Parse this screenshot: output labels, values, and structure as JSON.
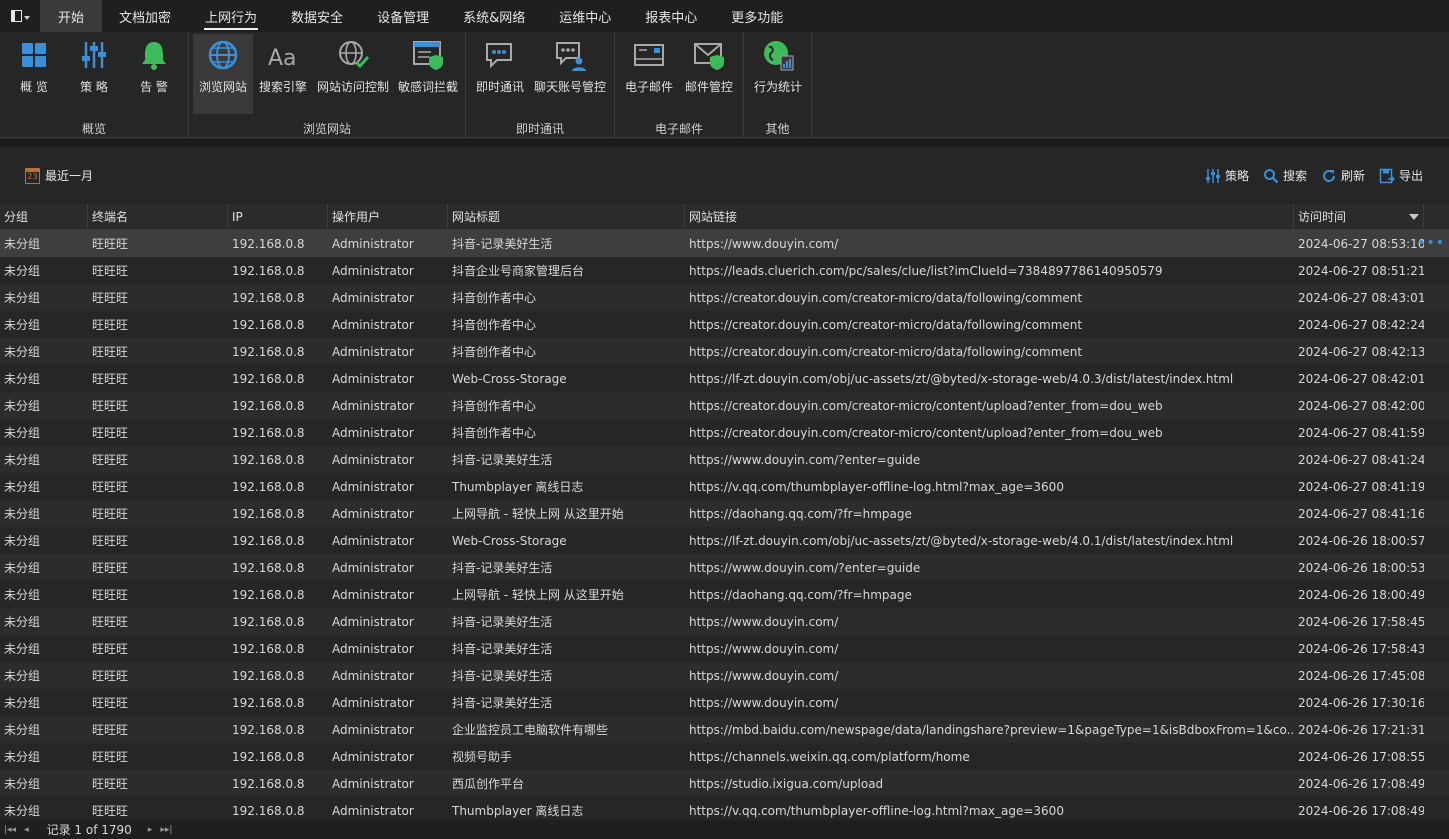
{
  "menu": {
    "tabs": [
      "开始",
      "文档加密",
      "上网行为",
      "数据安全",
      "设备管理",
      "系统&网络",
      "运维中心",
      "报表中心",
      "更多功能"
    ],
    "active_index": 2
  },
  "ribbon": {
    "groups": [
      {
        "label": "概览",
        "buttons": [
          {
            "label": "概 览",
            "icon": "overview-grid-icon"
          },
          {
            "label": "策 略",
            "icon": "policy-sliders-icon"
          },
          {
            "label": "告 警",
            "icon": "alarm-bell-icon"
          }
        ]
      },
      {
        "label": "浏览网站",
        "buttons": [
          {
            "label": "浏览网站",
            "icon": "globe-icon"
          },
          {
            "label": "搜索引擎",
            "icon": "search-engine-aa-icon"
          },
          {
            "label": "网站访问控制",
            "icon": "globe-check-icon"
          },
          {
            "label": "敏感词拦截",
            "icon": "browser-shield-icon"
          }
        ]
      },
      {
        "label": "即时通讯",
        "buttons": [
          {
            "label": "即时通讯",
            "icon": "chat-bubble-icon"
          },
          {
            "label": "聊天账号管控",
            "icon": "chat-user-icon"
          }
        ]
      },
      {
        "label": "电子邮件",
        "buttons": [
          {
            "label": "电子邮件",
            "icon": "mail-icon"
          },
          {
            "label": "邮件管控",
            "icon": "mail-shield-icon"
          }
        ]
      },
      {
        "label": "其他",
        "buttons": [
          {
            "label": "行为统计",
            "icon": "globe-stats-icon"
          }
        ]
      }
    ]
  },
  "toolbar": {
    "date_filter": "最近一月",
    "calendar_day": "23",
    "policy": "策略",
    "search": "搜索",
    "refresh": "刷新",
    "export": "导出"
  },
  "table": {
    "columns": [
      "分组",
      "终端名",
      "IP",
      "操作用户",
      "网站标题",
      "网站链接",
      "访问时间"
    ],
    "rows": [
      [
        "未分组",
        "旺旺旺",
        "192.168.0.8",
        "Administrator",
        "抖音-记录美好生活",
        "https://www.douyin.com/",
        "2024-06-27 08:53:10"
      ],
      [
        "未分组",
        "旺旺旺",
        "192.168.0.8",
        "Administrator",
        "抖音企业号商家管理后台",
        "https://leads.cluerich.com/pc/sales/clue/list?imClueId=7384897786140950579",
        "2024-06-27 08:51:21"
      ],
      [
        "未分组",
        "旺旺旺",
        "192.168.0.8",
        "Administrator",
        "抖音创作者中心",
        "https://creator.douyin.com/creator-micro/data/following/comment",
        "2024-06-27 08:43:01"
      ],
      [
        "未分组",
        "旺旺旺",
        "192.168.0.8",
        "Administrator",
        "抖音创作者中心",
        "https://creator.douyin.com/creator-micro/data/following/comment",
        "2024-06-27 08:42:24"
      ],
      [
        "未分组",
        "旺旺旺",
        "192.168.0.8",
        "Administrator",
        "抖音创作者中心",
        "https://creator.douyin.com/creator-micro/data/following/comment",
        "2024-06-27 08:42:13"
      ],
      [
        "未分组",
        "旺旺旺",
        "192.168.0.8",
        "Administrator",
        "Web-Cross-Storage",
        "https://lf-zt.douyin.com/obj/uc-assets/zt/@byted/x-storage-web/4.0.3/dist/latest/index.html",
        "2024-06-27 08:42:01"
      ],
      [
        "未分组",
        "旺旺旺",
        "192.168.0.8",
        "Administrator",
        "抖音创作者中心",
        "https://creator.douyin.com/creator-micro/content/upload?enter_from=dou_web",
        "2024-06-27 08:42:00"
      ],
      [
        "未分组",
        "旺旺旺",
        "192.168.0.8",
        "Administrator",
        "抖音创作者中心",
        "https://creator.douyin.com/creator-micro/content/upload?enter_from=dou_web",
        "2024-06-27 08:41:59"
      ],
      [
        "未分组",
        "旺旺旺",
        "192.168.0.8",
        "Administrator",
        "抖音-记录美好生活",
        "https://www.douyin.com/?enter=guide",
        "2024-06-27 08:41:24"
      ],
      [
        "未分组",
        "旺旺旺",
        "192.168.0.8",
        "Administrator",
        "Thumbplayer 离线日志",
        "https://v.qq.com/thumbplayer-offline-log.html?max_age=3600",
        "2024-06-27 08:41:19"
      ],
      [
        "未分组",
        "旺旺旺",
        "192.168.0.8",
        "Administrator",
        "上网导航 - 轻快上网 从这里开始",
        "https://daohang.qq.com/?fr=hmpage",
        "2024-06-27 08:41:16"
      ],
      [
        "未分组",
        "旺旺旺",
        "192.168.0.8",
        "Administrator",
        "Web-Cross-Storage",
        "https://lf-zt.douyin.com/obj/uc-assets/zt/@byted/x-storage-web/4.0.1/dist/latest/index.html",
        "2024-06-26 18:00:57"
      ],
      [
        "未分组",
        "旺旺旺",
        "192.168.0.8",
        "Administrator",
        "抖音-记录美好生活",
        "https://www.douyin.com/?enter=guide",
        "2024-06-26 18:00:53"
      ],
      [
        "未分组",
        "旺旺旺",
        "192.168.0.8",
        "Administrator",
        "上网导航 - 轻快上网 从这里开始",
        "https://daohang.qq.com/?fr=hmpage",
        "2024-06-26 18:00:49"
      ],
      [
        "未分组",
        "旺旺旺",
        "192.168.0.8",
        "Administrator",
        "抖音-记录美好生活",
        "https://www.douyin.com/",
        "2024-06-26 17:58:45"
      ],
      [
        "未分组",
        "旺旺旺",
        "192.168.0.8",
        "Administrator",
        "抖音-记录美好生活",
        "https://www.douyin.com/",
        "2024-06-26 17:58:43"
      ],
      [
        "未分组",
        "旺旺旺",
        "192.168.0.8",
        "Administrator",
        "抖音-记录美好生活",
        "https://www.douyin.com/",
        "2024-06-26 17:45:08"
      ],
      [
        "未分组",
        "旺旺旺",
        "192.168.0.8",
        "Administrator",
        "抖音-记录美好生活",
        "https://www.douyin.com/",
        "2024-06-26 17:30:16"
      ],
      [
        "未分组",
        "旺旺旺",
        "192.168.0.8",
        "Administrator",
        "企业监控员工电脑软件有哪些",
        "https://mbd.baidu.com/newspage/data/landingshare?preview=1&pageType=1&isBdboxFrom=1&co...",
        "2024-06-26 17:21:31"
      ],
      [
        "未分组",
        "旺旺旺",
        "192.168.0.8",
        "Administrator",
        "视频号助手",
        "https://channels.weixin.qq.com/platform/home",
        "2024-06-26 17:08:55"
      ],
      [
        "未分组",
        "旺旺旺",
        "192.168.0.8",
        "Administrator",
        "西瓜创作平台",
        "https://studio.ixigua.com/upload",
        "2024-06-26 17:08:49"
      ],
      [
        "未分组",
        "旺旺旺",
        "192.168.0.8",
        "Administrator",
        "Thumbplayer 离线日志",
        "https://v.qq.com/thumbplayer-offline-log.html?max_age=3600",
        "2024-06-26 17:08:49"
      ]
    ],
    "selected_row": 0,
    "row_more": "•••"
  },
  "status": {
    "record_label": "记录 1 of 1790"
  },
  "colors": {
    "accent_blue": "#3a8fd8",
    "accent_green": "#3dbb5a"
  }
}
